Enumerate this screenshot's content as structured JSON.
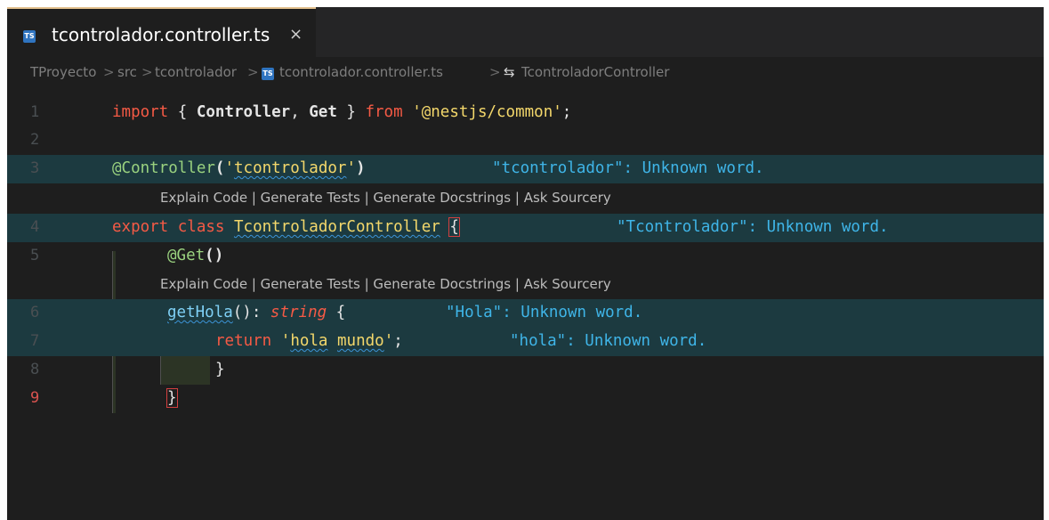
{
  "tab": {
    "badge": "TS",
    "file_name": "tcontrolador.controller.ts",
    "close_glyph": "×"
  },
  "breadcrumb": {
    "project": "TProyecto",
    "folder1": "src",
    "folder2": "tcontrolador",
    "file": "tcontrolador.controller.ts",
    "symbol": "TcontroladorController",
    "symbol_icon": "⇆",
    "separator": ">"
  },
  "code": {
    "line_numbers": [
      "1",
      "2",
      "3",
      "4",
      "5",
      "6",
      "7",
      "8",
      "9"
    ],
    "line1": {
      "kw": "import",
      "open": " { ",
      "a": "Controller",
      "comma": ", ",
      "b": "Get",
      "close": " } ",
      "from": "from",
      "sp": " ",
      "str": "'@nestjs/common'",
      "semi": ";"
    },
    "line3": {
      "deco": "@Controller",
      "p1": "(",
      "q1": "'",
      "word": "tcontrolador",
      "q2": "'",
      "p2": ")",
      "msg": "\"tcontrolador\": Unknown word."
    },
    "lens3": "Explain Code | Generate Tests | Generate Docstrings | Ask Sourcery",
    "line4": {
      "kw1": "export",
      "kw2": "class",
      "name": "TcontroladorController",
      "brace": "{",
      "msg": "\"Tcontrolador\": Unknown word."
    },
    "line5": {
      "deco": "@Get",
      "parens": "()"
    },
    "lens5": "Explain Code | Generate Tests | Generate Docstrings | Ask Sourcery",
    "line6": {
      "fn": "getHola",
      "rest": "(): ",
      "type": "string",
      "brace": " {",
      "msg": "\"Hola\": Unknown word."
    },
    "line7": {
      "kw": "return",
      "q1": "'",
      "w1": "hola",
      "sp": " ",
      "w2": "mundo",
      "q2": "'",
      "semi": ";",
      "msg": "\"hola\": Unknown word."
    },
    "line8": {
      "brace": "}"
    },
    "line9": {
      "brace": "}"
    }
  },
  "colors": {
    "editor_bg": "#1e1e1e",
    "highlight_line": "#1c3a40",
    "keyword": "#f55a45",
    "string": "#f4d86b",
    "decorator": "#9ad27f",
    "message": "#3fb5e8"
  }
}
